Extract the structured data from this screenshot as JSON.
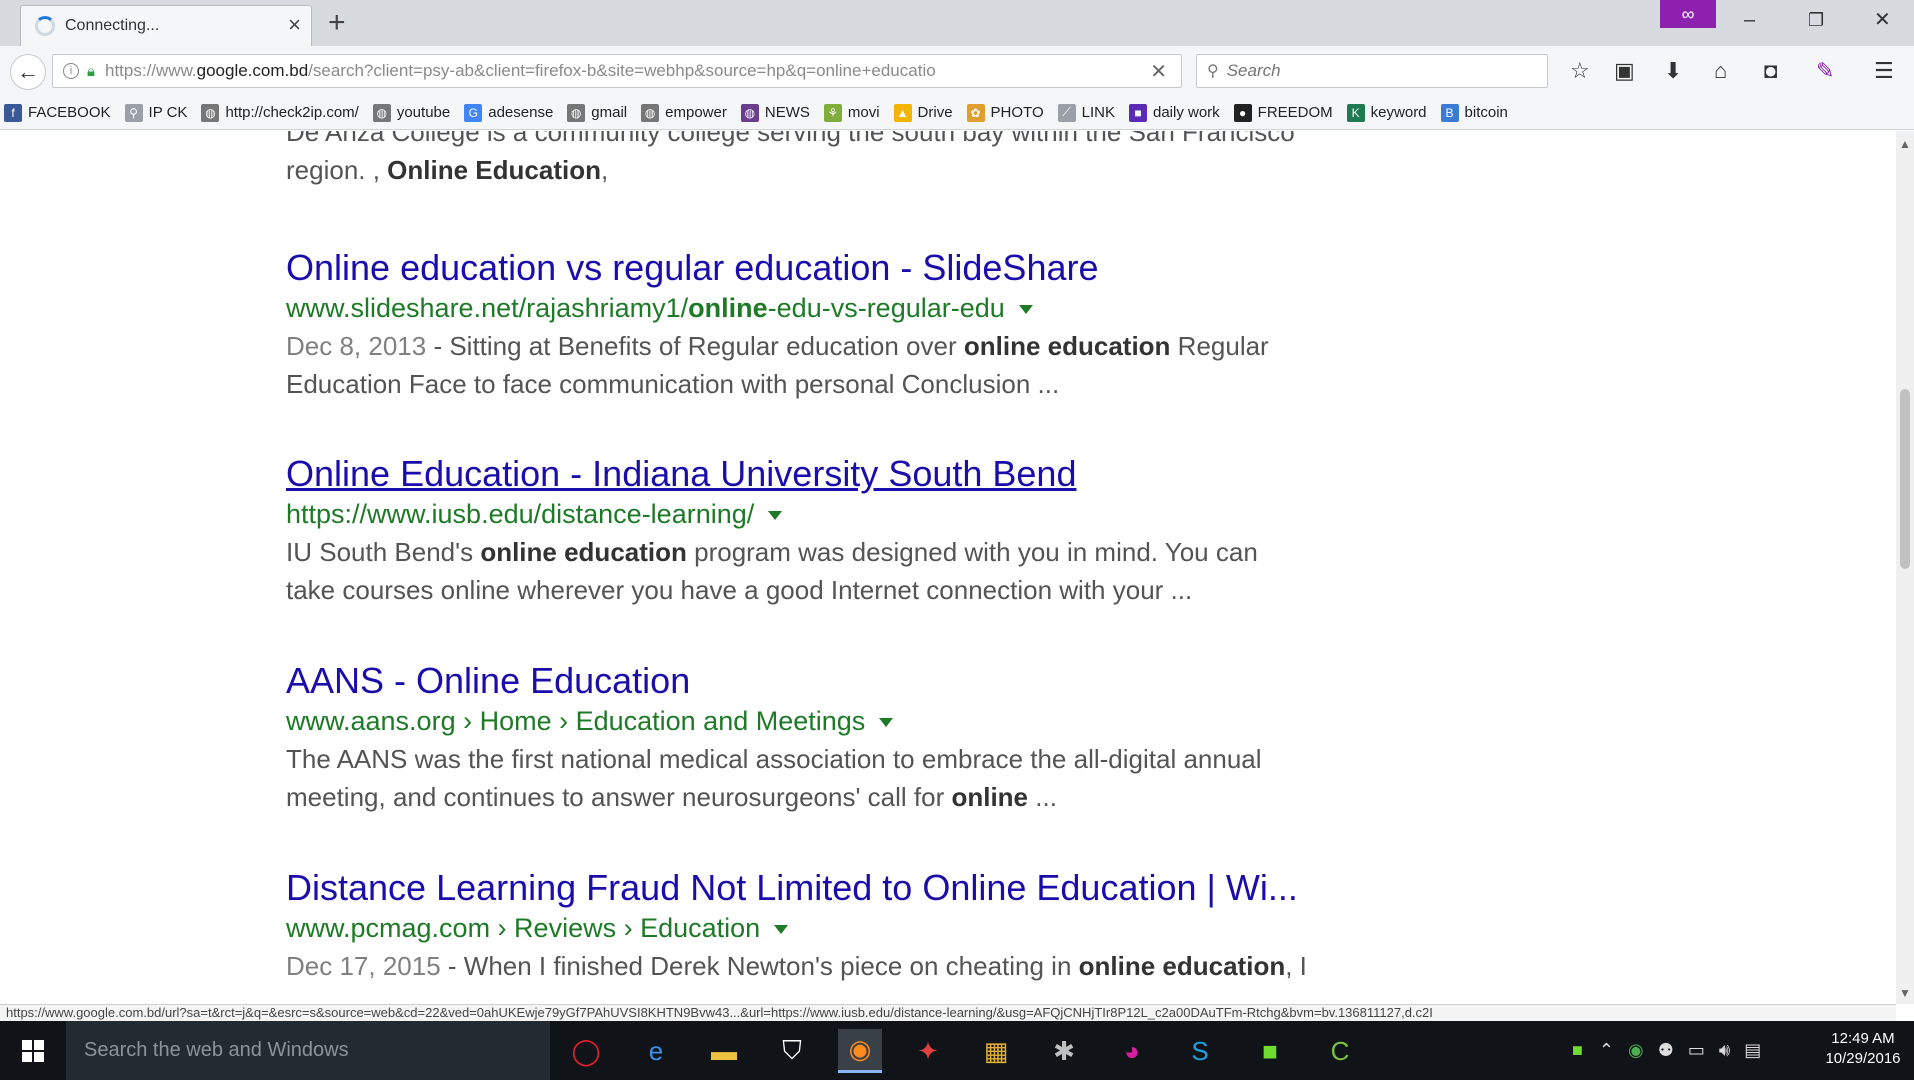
{
  "tab": {
    "title": "Connecting...",
    "close": "×"
  },
  "newtab": "+",
  "window": {
    "minimize": "–",
    "restore": "❐",
    "close": "✕"
  },
  "nav": {
    "url_prefix": "https://www.",
    "url_domain": "google.com.bd",
    "url_rest": "/search?client=psy-ab&client=firefox-b&site=webhp&source=hp&q=online+educatio",
    "search_placeholder": "Search"
  },
  "bookmarks": [
    {
      "label": "FACEBOOK",
      "icon": "facebook-icon",
      "color": "#3b5998",
      "glyph": "f"
    },
    {
      "label": "IP CK",
      "icon": "search-icon",
      "color": "#9aa0a6",
      "glyph": "⚲"
    },
    {
      "label": "http://check2ip.com/",
      "icon": "globe-icon",
      "color": "#777777",
      "glyph": "◍"
    },
    {
      "label": "youtube",
      "icon": "globe-icon",
      "color": "#777777",
      "glyph": "◍"
    },
    {
      "label": "adesense",
      "icon": "google-icon",
      "color": "#4285f4",
      "glyph": "G"
    },
    {
      "label": "gmail",
      "icon": "globe-icon",
      "color": "#777777",
      "glyph": "◍"
    },
    {
      "label": "empower",
      "icon": "globe-icon",
      "color": "#777777",
      "glyph": "◍"
    },
    {
      "label": "NEWS",
      "icon": "globe-icon",
      "color": "#6a3e8e",
      "glyph": "◍"
    },
    {
      "label": "movi",
      "icon": "folder-icon",
      "color": "#7fae3c",
      "glyph": "⚘"
    },
    {
      "label": "Drive",
      "icon": "drive-icon",
      "color": "#f4b400",
      "glyph": "▲"
    },
    {
      "label": "PHOTO",
      "icon": "photo-icon",
      "color": "#e0a030",
      "glyph": "✿"
    },
    {
      "label": "LINK",
      "icon": "link-icon",
      "color": "#9aa0a6",
      "glyph": "⟋"
    },
    {
      "label": "daily work",
      "icon": "square-icon",
      "color": "#5b2bb5",
      "glyph": "■"
    },
    {
      "label": "FREEDOM",
      "icon": "dark-circle-icon",
      "color": "#222222",
      "glyph": "●"
    },
    {
      "label": "keyword",
      "icon": "keyword-icon",
      "color": "#1e7a50",
      "glyph": "K"
    },
    {
      "label": "bitcoin",
      "icon": "bitcoin-icon",
      "color": "#3a7bd5",
      "glyph": "B"
    }
  ],
  "content": {
    "top_snippet_line1": "De Anza College is a community college serving the south bay within the San Francisco",
    "top_snippet_line2_a": "region. , ",
    "top_snippet_line2_b": "Online Education",
    "top_snippet_line2_c": ",",
    "results": [
      {
        "title": "Online education vs regular education - SlideShare",
        "url_a": "www.slideshare.net/rajashriamy1/",
        "url_b": "online",
        "url_c": "-edu-vs-regular-edu",
        "date": "Dec 8, 2013",
        "s1": " - Sitting at Benefits of Regular education over ",
        "s1b": "online education",
        "s1c": " Regular",
        "s2": "Education Face to face communication with personal Conclusion ..."
      },
      {
        "title": "Online Education - Indiana University South Bend",
        "url": "https://www.iusb.edu/distance-learning/",
        "s1": "IU South Bend's ",
        "s1b": "online education",
        "s1c": " program was designed with you in mind. You can",
        "s2": "take courses online wherever you have a good Internet connection with your ..."
      },
      {
        "title": "AANS - Online Education",
        "url": "www.aans.org › Home › Education and Meetings",
        "s1": "The AANS was the first national medical association to embrace the all-digital annual",
        "s2a": "meeting, and continues to answer neurosurgeons' call for ",
        "s2b": "online",
        "s2c": " ..."
      },
      {
        "title": "Distance Learning Fraud Not Limited to Online Education | Wi...",
        "url": "www.pcmag.com › Reviews › Education",
        "date": "Dec 17, 2015",
        "s1": " - When I finished Derek Newton's piece on cheating in ",
        "s1b": "online education",
        "s1c": ", I"
      }
    ]
  },
  "statusbar": "https://www.google.com.bd/url?sa=t&rct=j&q=&esrc=s&source=web&cd=22&ved=0ahUKEwje79yGf7PAhUVSI8KHTN9Bvw43...&url=https://www.iusb.edu/distance-learning/&usg=AFQjCNHjTIr8P12L_c2a00DAuTFm-Rtchg&bvm=bv.136811127,d.c2I",
  "taskbar": {
    "search_placeholder": "Search the web and Windows",
    "time": "12:49 AM",
    "date": "10/29/2016"
  }
}
